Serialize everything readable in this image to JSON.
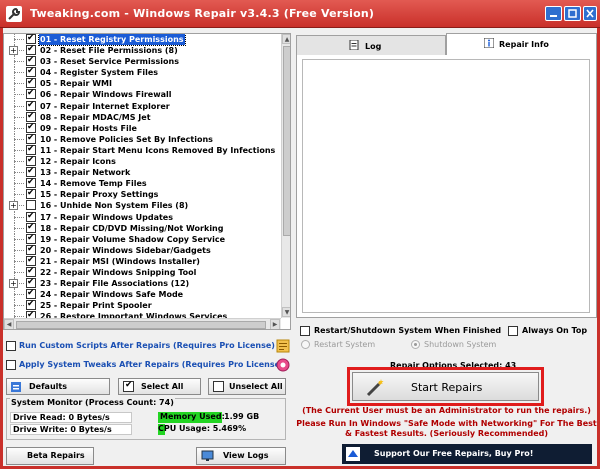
{
  "window": {
    "title": "Tweaking.com - Windows Repair v3.4.3 (Free Version)",
    "minimize_icon": "minimize-icon",
    "maximize_icon": "maximize-icon",
    "close_icon": "close-icon"
  },
  "repairs": [
    {
      "label": "01 - Reset Registry Permissions",
      "checked": true,
      "expandable": false,
      "selected": true
    },
    {
      "label": "02 - Reset File Permissions (8)",
      "checked": true,
      "expandable": true
    },
    {
      "label": "03 - Reset Service Permissions",
      "checked": true,
      "expandable": false
    },
    {
      "label": "04 - Register System Files",
      "checked": true,
      "expandable": false
    },
    {
      "label": "05 - Repair WMI",
      "checked": true,
      "expandable": false
    },
    {
      "label": "06 - Repair Windows Firewall",
      "checked": true,
      "expandable": false
    },
    {
      "label": "07 - Repair Internet Explorer",
      "checked": true,
      "expandable": false
    },
    {
      "label": "08 - Repair MDAC/MS Jet",
      "checked": true,
      "expandable": false
    },
    {
      "label": "09 - Repair Hosts File",
      "checked": true,
      "expandable": false
    },
    {
      "label": "10 - Remove Policies Set By Infections",
      "checked": true,
      "expandable": false
    },
    {
      "label": "11 - Repair Start Menu Icons Removed By Infections",
      "checked": true,
      "expandable": false
    },
    {
      "label": "12 - Repair Icons",
      "checked": true,
      "expandable": false
    },
    {
      "label": "13 - Repair Network",
      "checked": true,
      "expandable": false
    },
    {
      "label": "14 - Remove Temp Files",
      "checked": true,
      "expandable": false
    },
    {
      "label": "15 - Repair Proxy Settings",
      "checked": true,
      "expandable": false
    },
    {
      "label": "16 - Unhide Non System Files (8)",
      "checked": false,
      "expandable": true
    },
    {
      "label": "17 - Repair Windows Updates",
      "checked": true,
      "expandable": false
    },
    {
      "label": "18 - Repair CD/DVD Missing/Not Working",
      "checked": true,
      "expandable": false
    },
    {
      "label": "19 - Repair Volume Shadow Copy Service",
      "checked": true,
      "expandable": false
    },
    {
      "label": "20 - Repair Windows Sidebar/Gadgets",
      "checked": true,
      "expandable": false
    },
    {
      "label": "21 - Repair MSI (Windows Installer)",
      "checked": true,
      "expandable": false
    },
    {
      "label": "22 - Repair Windows Snipping Tool",
      "checked": true,
      "expandable": false
    },
    {
      "label": "23 - Repair File Associations (12)",
      "checked": true,
      "expandable": true
    },
    {
      "label": "24 - Repair Windows Safe Mode",
      "checked": true,
      "expandable": false
    },
    {
      "label": "25 - Repair Print Spooler",
      "checked": true,
      "expandable": false
    },
    {
      "label": "26 - Restore Important Windows Services",
      "checked": true,
      "expandable": false
    }
  ],
  "options": {
    "custom_scripts": "Run Custom Scripts After Repairs (Requires Pro License)",
    "system_tweaks": "Apply System Tweaks After Repairs (Requires Pro License)"
  },
  "buttons": {
    "defaults": "Defaults",
    "select_all": "Select All",
    "unselect_all": "Unselect All",
    "beta_repairs": "Beta Repairs",
    "view_logs": "View Logs",
    "start_repairs": "Start Repairs",
    "support": "Support Our Free Repairs, Buy Pro!"
  },
  "monitor": {
    "title": "System Monitor (Process Count: 74)",
    "drive_read": "Drive Read: 0 Bytes/s",
    "drive_write": "Drive Write: 0 Bytes/s",
    "memory_label": "Memory Used:",
    "memory_value": "1.99 GB",
    "cpu": "CPU Usage: 5.469%",
    "cpu_fraction": 0.05469
  },
  "tabs": {
    "log": "Log",
    "repair_info": "Repair Info"
  },
  "restart": {
    "label": "Restart/Shutdown System When Finished",
    "always_on_top": "Always On Top",
    "radio_restart": "Restart System",
    "radio_shutdown": "Shutdown System"
  },
  "status": {
    "options_selected": "Repair Options Selected: 43",
    "admin_notice": "(The Current User must be an Administrator to run the repairs.)",
    "safe_mode_notice": "Please Run In Windows \"Safe Mode with Networking\" For The Best & Fastest Results. (Seriously Recommended)"
  },
  "colors": {
    "title_bar": "#c9302a",
    "selection": "#1a5bd6",
    "memory_badge": "#22d522",
    "highlight_border": "#e01c1c",
    "notice_text": "#b00000",
    "option_text": "#1a4fb3",
    "support_bg": "#0f1d33"
  }
}
